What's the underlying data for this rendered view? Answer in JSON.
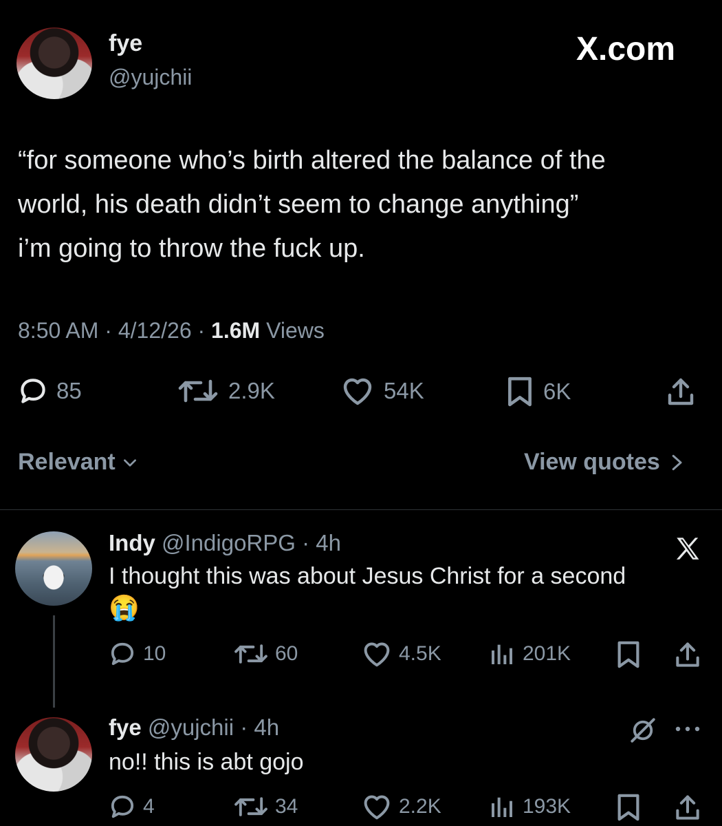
{
  "main_tweet": {
    "display_name": "fye",
    "handle": "@yujchii",
    "site": "X.com",
    "text_lines": [
      "“for someone who’s birth altered the balance of the",
      "world, his death didn’t seem to change anything”",
      "i’m going to throw the fuck up."
    ],
    "time": "8:50 AM",
    "date": "4/12/26",
    "views_count": "1.6M",
    "views_label": "Views",
    "separator": "·",
    "replies": "85",
    "reposts": "2.9K",
    "likes": "54K",
    "bookmarks": "6K"
  },
  "controls": {
    "sort_label": "Relevant",
    "view_quotes_label": "View quotes"
  },
  "replies": [
    {
      "display_name": "Indy",
      "handle": "@IndigoRPG",
      "age": "· 4h",
      "text": "I thought this was about Jesus Christ for a second",
      "emoji": "😭",
      "replies": "10",
      "reposts": "60",
      "likes": "4.5K",
      "views": "201K"
    },
    {
      "display_name": "fye",
      "handle": "@yujchii",
      "age": "· 4h",
      "text": "no!! this is abt gojo",
      "replies": "4",
      "reposts": "34",
      "likes": "2.2K",
      "views": "193K"
    }
  ]
}
